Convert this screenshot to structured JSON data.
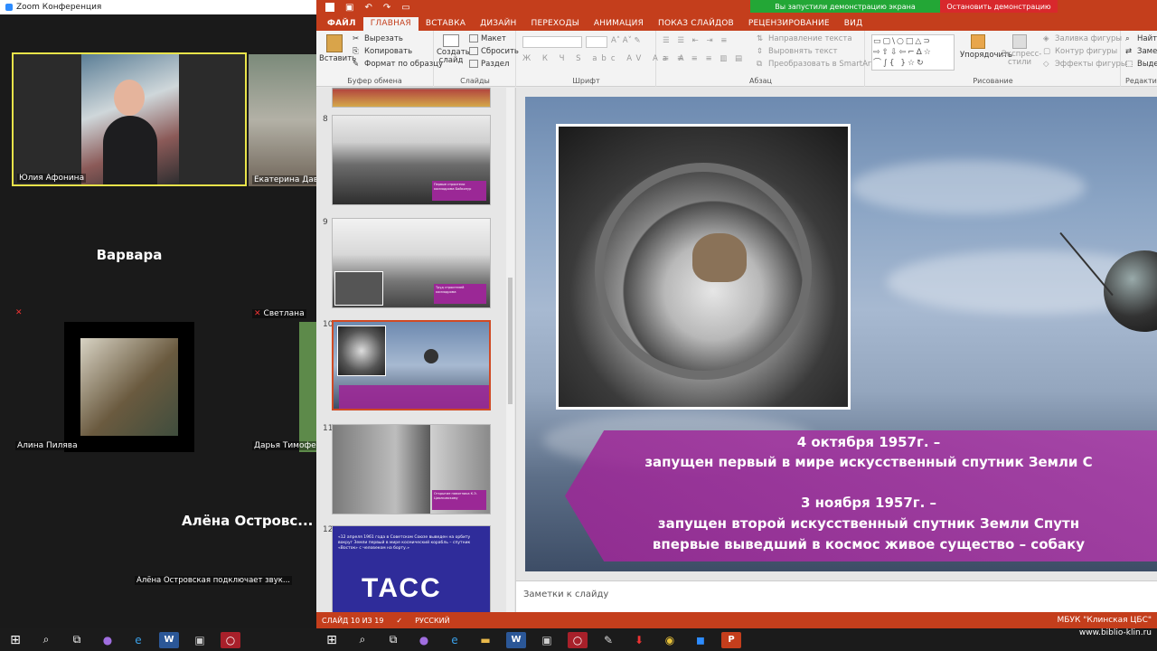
{
  "zoom": {
    "window_title": "Zoom Конференция",
    "participants": [
      {
        "name": "Юлия Афонина",
        "video": true,
        "active_speaker": true
      },
      {
        "name": "Екатерина Давыдова",
        "video": true
      },
      {
        "name": "Варвара",
        "video": false,
        "display": "Варвара"
      },
      {
        "name": "Светлана",
        "video": false,
        "muted": true
      },
      {
        "name": "Алина Пилява",
        "video": true
      },
      {
        "name": "Дарья Тимофеева",
        "video": true
      },
      {
        "name": "Алёна Островская подключает звук...",
        "video": false,
        "display": "Алёна Островс..."
      }
    ],
    "mute_icon": "mic-off-icon"
  },
  "ppt": {
    "share_notice": "Вы запустили демонстрацию экрана",
    "stop_share": "Остановить демонстрацию",
    "tabs": [
      "ФАЙЛ",
      "ГЛАВНАЯ",
      "ВСТАВКА",
      "ДИЗАЙН",
      "ПЕРЕХОДЫ",
      "АНИМАЦИЯ",
      "ПОКАЗ СЛАЙДОВ",
      "РЕЦЕНЗИРОВАНИЕ",
      "ВИД"
    ],
    "ribbon": {
      "paste": "Вставить",
      "cut": "Вырезать",
      "copy": "Копировать",
      "format_painter": "Формат по образцу",
      "clipboard_group": "Буфер обмена",
      "new_slide": "Создать слайд",
      "layout": "Макет",
      "reset": "Сбросить",
      "section": "Раздел",
      "slides_group": "Слайды",
      "font_group": "Шрифт",
      "text_direction": "Направление текста",
      "align_text": "Выровнять текст",
      "convert_smartart": "Преобразовать в SmartArt",
      "paragraph_group": "Абзац",
      "arrange": "Упорядочить",
      "quick_styles": "Экспресс-стили",
      "shape_fill": "Заливка фигуры",
      "shape_outline": "Контур фигуры",
      "shape_effects": "Эффекты фигуры",
      "drawing_group": "Рисование",
      "find": "Найти",
      "replace": "Заменить",
      "select": "Выделить",
      "editing_group": "Редактирование"
    },
    "thumbnails": [
      {
        "num": "8",
        "caption": "Первые строители космодрома Байконур"
      },
      {
        "num": "9",
        "caption": "Труд строителей космодрома"
      },
      {
        "num": "10",
        "selected": true
      },
      {
        "num": "11",
        "caption": "Открытие памятника К.Э. Циолковскому"
      },
      {
        "num": "12",
        "tass_text": "«12 апреля 1961 года в Советском Союзе выведен на орбиту вокруг Земли первый в мире космический корабль – спутник «Восток» с человеком на борту.»",
        "logo": "ТАСС"
      }
    ],
    "slide": {
      "line1": "4 октября 1957г. –",
      "line2": "запущен первый в мире искусственный спутник Земли С",
      "line3": "3 ноября 1957г. –",
      "line4": "запущен второй искусственный спутник Земли Спутн",
      "line5": "впервые выведший в космос живое существо – собаку"
    },
    "notes_placeholder": "Заметки к слайду",
    "status": {
      "slide_counter": "СЛАЙД 10 ИЗ 19",
      "language": "РУССКИЙ",
      "org": "МБУК \"Клинская ЦБС\""
    },
    "watermark": "www.biblio-klin.ru"
  },
  "colors": {
    "ppt_accent": "#c43e1c",
    "zoom_speaker_border": "#e8e34a",
    "banner": "#9b2896"
  }
}
